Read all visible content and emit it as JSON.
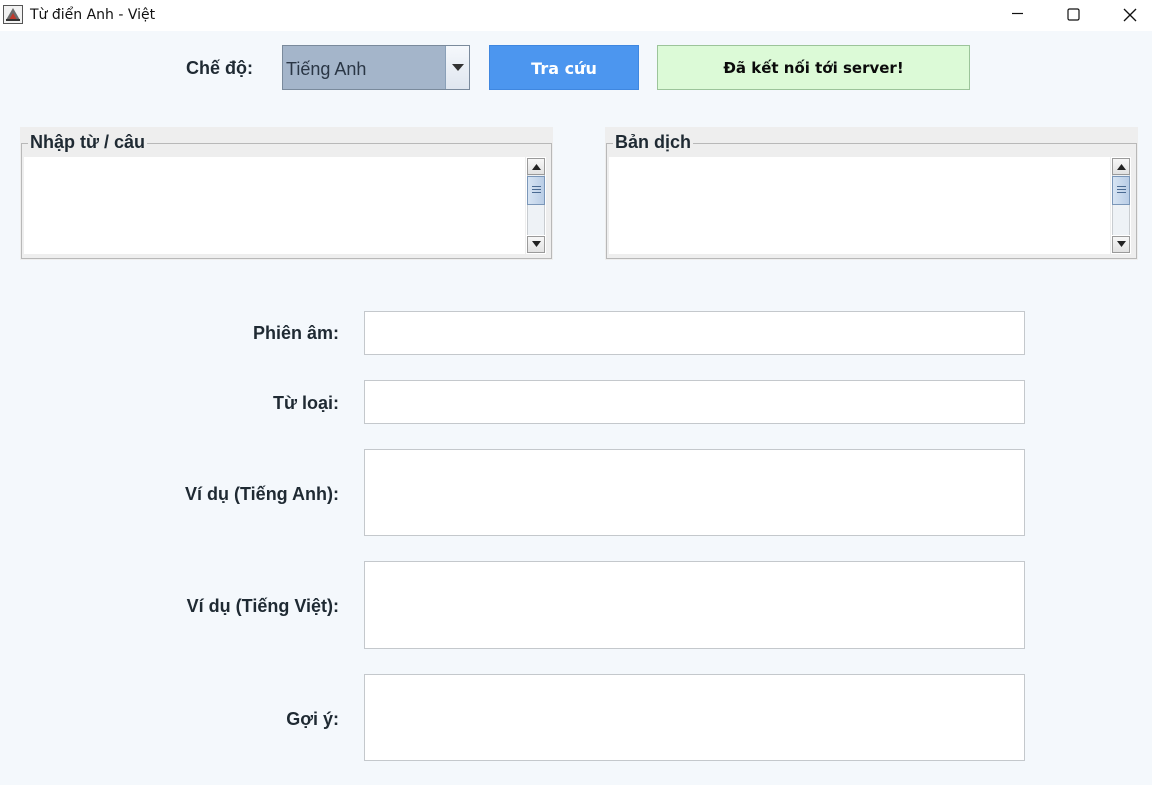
{
  "window": {
    "title": "Từ điển Anh - Việt",
    "icons": {
      "app": "java-app-icon",
      "minimize": "minimize-icon",
      "maximize": "maximize-icon",
      "close": "close-icon"
    }
  },
  "toolbar": {
    "mode_label": "Chế độ:",
    "mode_selected": "Tiếng Anh",
    "lookup_button": "Tra cứu",
    "status": "Đã kết nối tới server!"
  },
  "panels": {
    "input": {
      "title": "Nhập từ / câu",
      "value": ""
    },
    "translation": {
      "title": "Bản dịch",
      "value": ""
    }
  },
  "form": {
    "phonetic": {
      "label": "Phiên âm:",
      "value": ""
    },
    "word_type": {
      "label": "Từ loại:",
      "value": ""
    },
    "example_en": {
      "label": "Ví dụ (Tiếng Anh):",
      "value": ""
    },
    "example_vi": {
      "label": "Ví dụ (Tiếng Việt):",
      "value": ""
    },
    "suggestion": {
      "label": "Gợi ý:",
      "value": ""
    }
  },
  "colors": {
    "background": "#f4f8fc",
    "combo": "#a4b5ca",
    "lookup_button": "#4c96ef",
    "status_bg": "#dcfad7",
    "status_border": "#9cc49a"
  }
}
